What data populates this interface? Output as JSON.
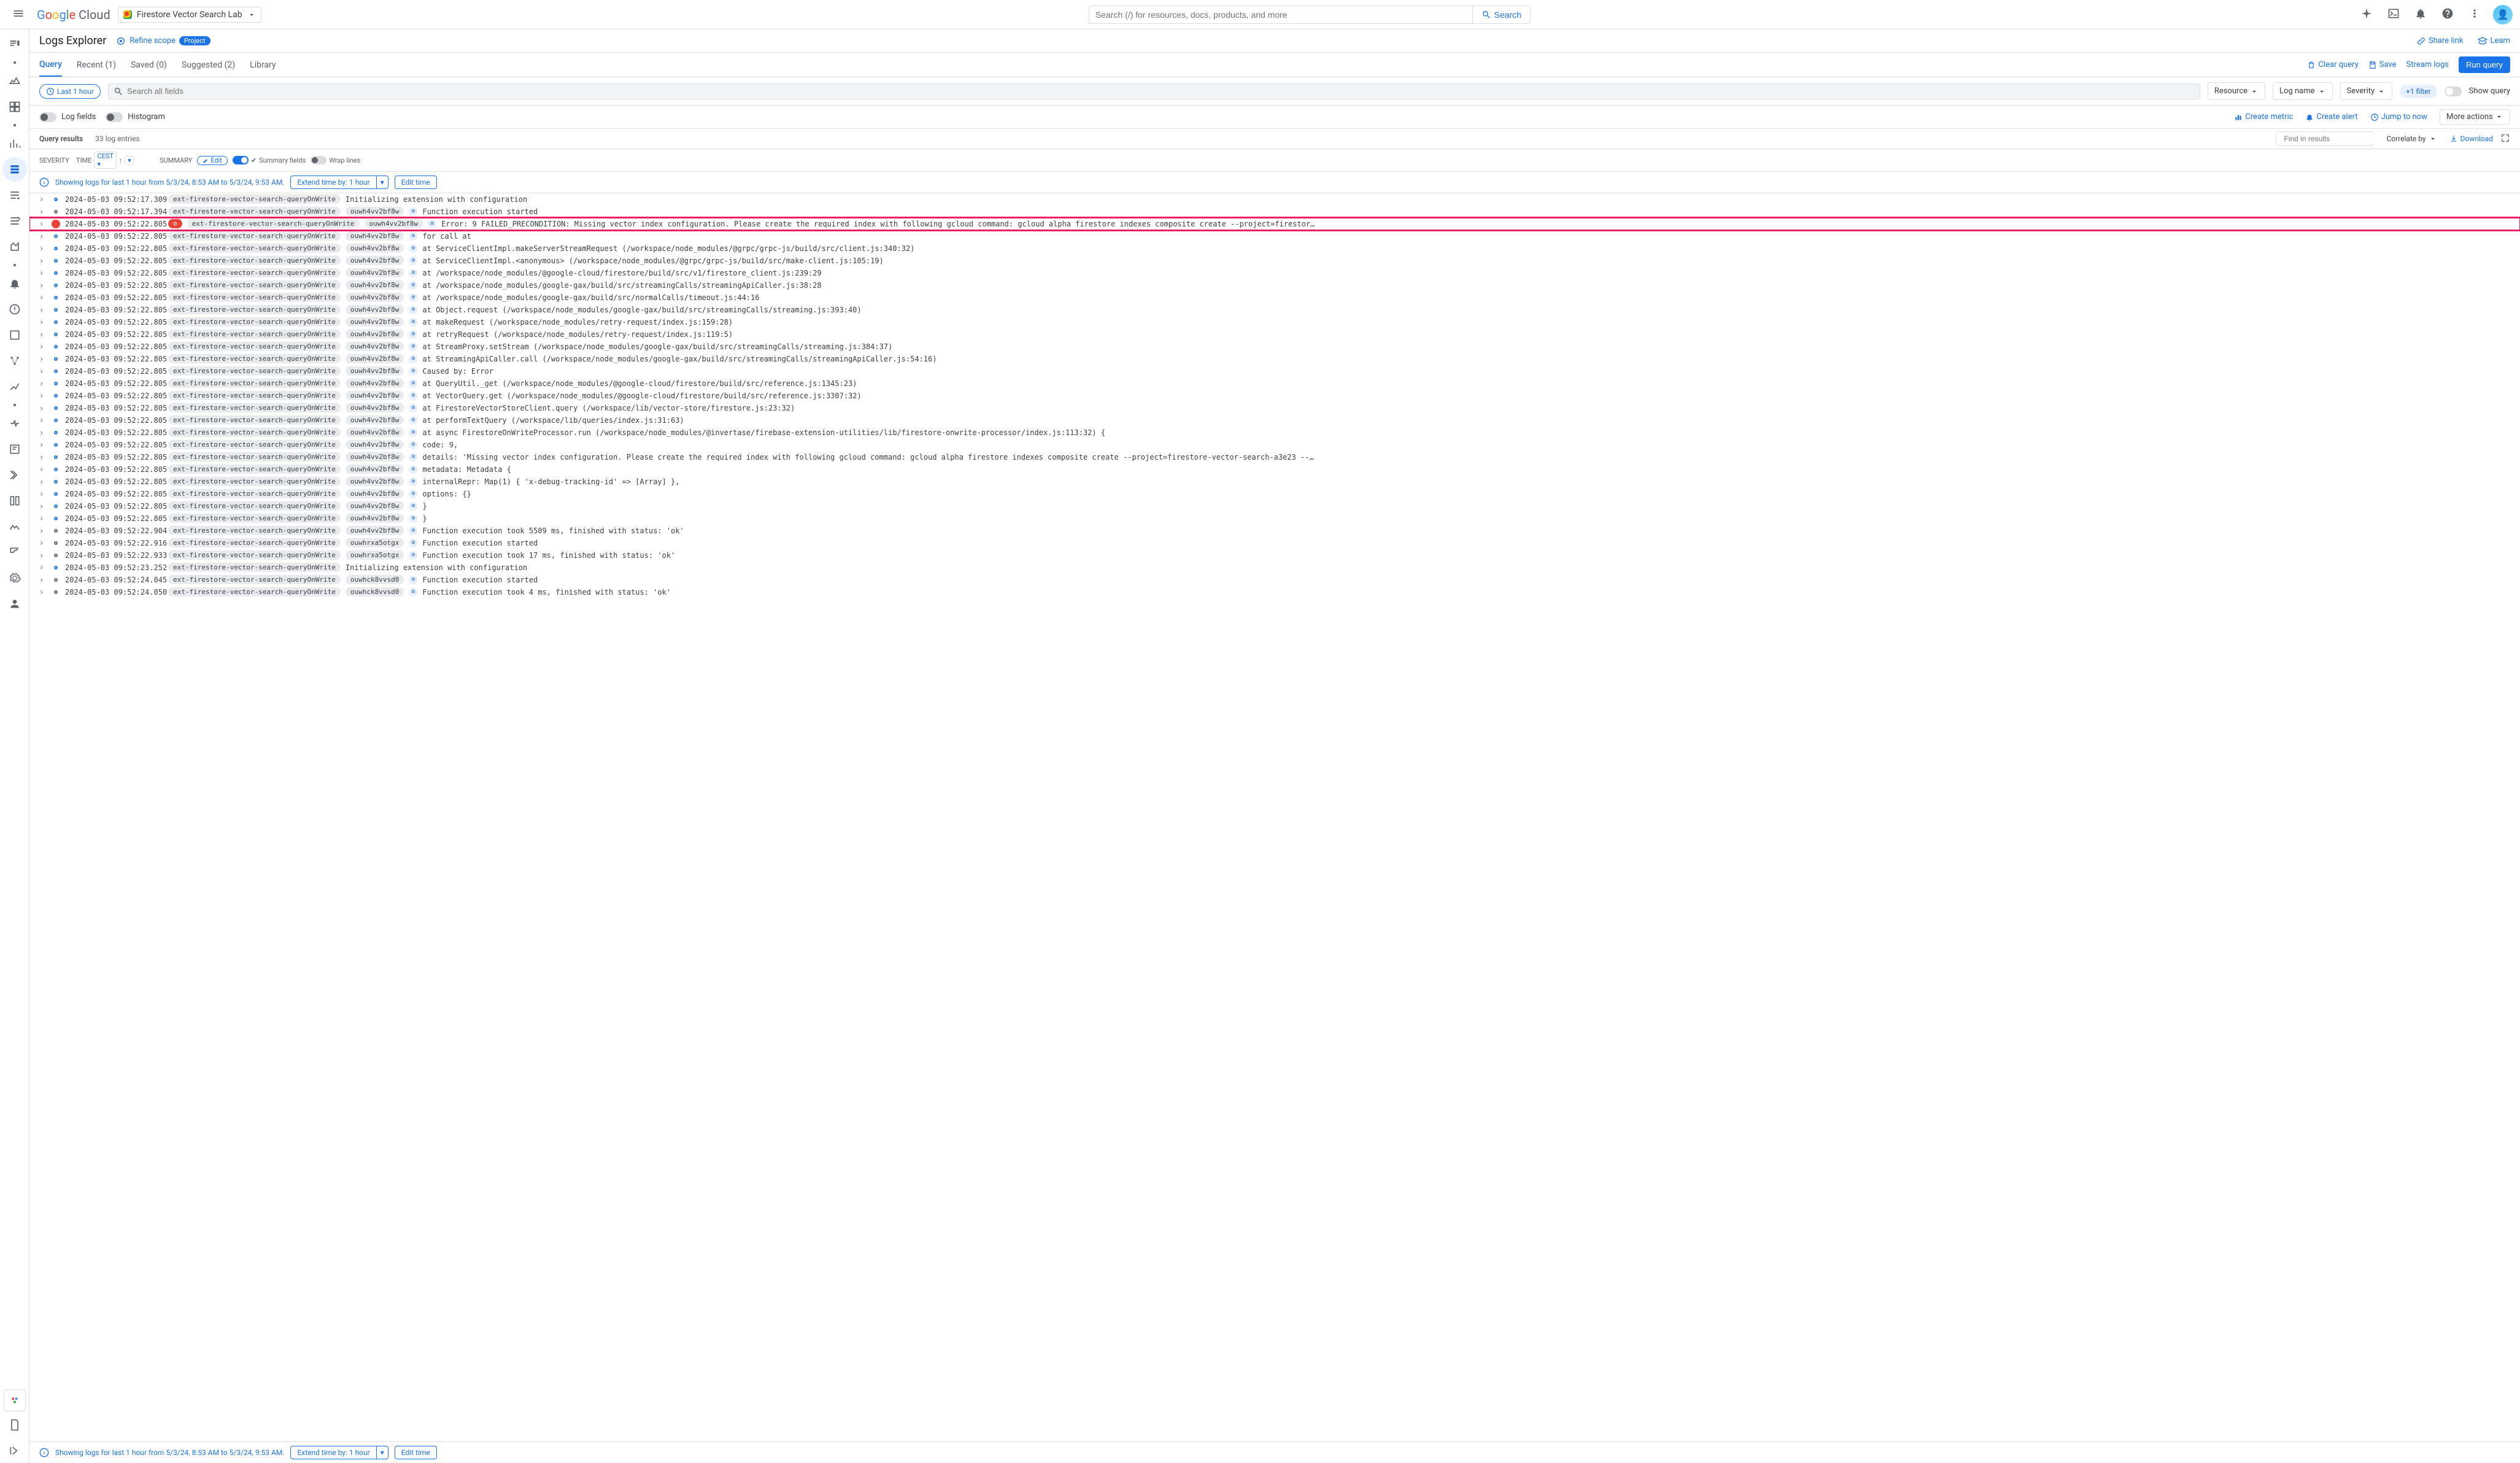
{
  "topbar": {
    "logo_text": "Google Cloud",
    "project_name": "Firestore Vector Search Lab",
    "search_placeholder": "Search (/) for resources, docs, products, and more",
    "search_button": "Search"
  },
  "subheader": {
    "title": "Logs Explorer",
    "refine_label": "Refine scope",
    "scope_chip": "Project",
    "share_link": "Share link",
    "learn": "Learn"
  },
  "tabs": {
    "query": "Query",
    "recent": "Recent (1)",
    "saved": "Saved (0)",
    "suggested": "Suggested (2)",
    "library": "Library",
    "clear_query": "Clear query",
    "save": "Save",
    "stream": "Stream logs",
    "run": "Run query"
  },
  "querybar": {
    "time_chip": "Last 1 hour",
    "search_placeholder": "Search all fields",
    "resource": "Resource",
    "log_name": "Log name",
    "severity": "Severity",
    "filter_chip": "+1 filter",
    "show_query": "Show query"
  },
  "fieldsbar": {
    "log_fields": "Log fields",
    "histogram": "Histogram",
    "create_metric": "Create metric",
    "create_alert": "Create alert",
    "jump": "Jump to now",
    "more": "More actions"
  },
  "results": {
    "label": "Query results",
    "count": "33 log entries",
    "find_placeholder": "Find in results",
    "correlate": "Correlate by",
    "download": "Download"
  },
  "columns": {
    "severity": "SEVERITY",
    "time": "TIME",
    "tz": "CEST",
    "summary": "SUMMARY",
    "edit": "Edit",
    "summary_fields": "Summary fields",
    "wrap": "Wrap lines"
  },
  "info": {
    "text": "Showing logs for last 1 hour from 5/3/24, 8:53 AM to 5/3/24, 9:53 AM.",
    "extend": "Extend time by: 1 hour",
    "edit_time": "Edit time"
  },
  "fn_name": "ext-firestore-vector-search-queryOnWrite",
  "exec_a": "ouwh4vv2bf8w",
  "exec_b": "ouwhrxa5otgx",
  "exec_c": "ouwhck8vvsd0",
  "logs": [
    {
      "sev": "info",
      "ts": "2024-05-03 09:52:17.309",
      "fn": true,
      "exec": "",
      "cf": false,
      "msg": "Initializing extension with configuration",
      "hl": false
    },
    {
      "sev": "debug",
      "ts": "2024-05-03 09:52:17.394",
      "fn": true,
      "exec": "a",
      "cf": true,
      "msg": "Function execution started",
      "hl": false
    },
    {
      "sev": "error",
      "ts": "2024-05-03 09:52:22.805",
      "fn": true,
      "exec": "a",
      "cf": true,
      "errpill": true,
      "msg": "Error: 9 FAILED_PRECONDITION: Missing vector index configuration. Please create the required index with following gcloud command: gcloud alpha firestore indexes composite create --project=firestor…",
      "hl": true
    },
    {
      "sev": "info",
      "ts": "2024-05-03 09:52:22.805",
      "fn": true,
      "exec": "a",
      "cf": true,
      "msg": "for call at",
      "hl": false
    },
    {
      "sev": "info",
      "ts": "2024-05-03 09:52:22.805",
      "fn": true,
      "exec": "a",
      "cf": true,
      "msg": "    at ServiceClientImpl.makeServerStreamRequest (/workspace/node_modules/@grpc/grpc-js/build/src/client.js:340:32)",
      "hl": false
    },
    {
      "sev": "info",
      "ts": "2024-05-03 09:52:22.805",
      "fn": true,
      "exec": "a",
      "cf": true,
      "msg": "    at ServiceClientImpl.<anonymous> (/workspace/node_modules/@grpc/grpc-js/build/src/make-client.js:105:19)",
      "hl": false
    },
    {
      "sev": "info",
      "ts": "2024-05-03 09:52:22.805",
      "fn": true,
      "exec": "a",
      "cf": true,
      "msg": "    at /workspace/node_modules/@google-cloud/firestore/build/src/v1/firestore_client.js:239:29",
      "hl": false
    },
    {
      "sev": "info",
      "ts": "2024-05-03 09:52:22.805",
      "fn": true,
      "exec": "a",
      "cf": true,
      "msg": "    at /workspace/node_modules/google-gax/build/src/streamingCalls/streamingApiCaller.js:38:28",
      "hl": false
    },
    {
      "sev": "info",
      "ts": "2024-05-03 09:52:22.805",
      "fn": true,
      "exec": "a",
      "cf": true,
      "msg": "    at /workspace/node_modules/google-gax/build/src/normalCalls/timeout.js:44:16",
      "hl": false
    },
    {
      "sev": "info",
      "ts": "2024-05-03 09:52:22.805",
      "fn": true,
      "exec": "a",
      "cf": true,
      "msg": "    at Object.request (/workspace/node_modules/google-gax/build/src/streamingCalls/streaming.js:393:40)",
      "hl": false
    },
    {
      "sev": "info",
      "ts": "2024-05-03 09:52:22.805",
      "fn": true,
      "exec": "a",
      "cf": true,
      "msg": "    at makeRequest (/workspace/node_modules/retry-request/index.js:159:28)",
      "hl": false
    },
    {
      "sev": "info",
      "ts": "2024-05-03 09:52:22.805",
      "fn": true,
      "exec": "a",
      "cf": true,
      "msg": "    at retryRequest (/workspace/node_modules/retry-request/index.js:119:5)",
      "hl": false
    },
    {
      "sev": "info",
      "ts": "2024-05-03 09:52:22.805",
      "fn": true,
      "exec": "a",
      "cf": true,
      "msg": "    at StreamProxy.setStream (/workspace/node_modules/google-gax/build/src/streamingCalls/streaming.js:384:37)",
      "hl": false
    },
    {
      "sev": "info",
      "ts": "2024-05-03 09:52:22.805",
      "fn": true,
      "exec": "a",
      "cf": true,
      "msg": "    at StreamingApiCaller.call (/workspace/node_modules/google-gax/build/src/streamingCalls/streamingApiCaller.js:54:16)",
      "hl": false
    },
    {
      "sev": "info",
      "ts": "2024-05-03 09:52:22.805",
      "fn": true,
      "exec": "a",
      "cf": true,
      "msg": "Caused by: Error",
      "hl": false
    },
    {
      "sev": "info",
      "ts": "2024-05-03 09:52:22.805",
      "fn": true,
      "exec": "a",
      "cf": true,
      "msg": "    at QueryUtil._get (/workspace/node_modules/@google-cloud/firestore/build/src/reference.js:1345:23)",
      "hl": false
    },
    {
      "sev": "info",
      "ts": "2024-05-03 09:52:22.805",
      "fn": true,
      "exec": "a",
      "cf": true,
      "msg": "    at VectorQuery.get (/workspace/node_modules/@google-cloud/firestore/build/src/reference.js:3307:32)",
      "hl": false
    },
    {
      "sev": "info",
      "ts": "2024-05-03 09:52:22.805",
      "fn": true,
      "exec": "a",
      "cf": true,
      "msg": "    at FirestoreVectorStoreClient.query (/workspace/lib/vector-store/firestore.js:23:32)",
      "hl": false
    },
    {
      "sev": "info",
      "ts": "2024-05-03 09:52:22.805",
      "fn": true,
      "exec": "a",
      "cf": true,
      "msg": "    at performTextQuery (/workspace/lib/queries/index.js:31:63)",
      "hl": false
    },
    {
      "sev": "info",
      "ts": "2024-05-03 09:52:22.805",
      "fn": true,
      "exec": "a",
      "cf": true,
      "msg": "    at async FirestoreOnWriteProcessor.run (/workspace/node_modules/@invertase/firebase-extension-utilities/lib/firestore-onwrite-processor/index.js:113:32) {",
      "hl": false
    },
    {
      "sev": "info",
      "ts": "2024-05-03 09:52:22.805",
      "fn": true,
      "exec": "a",
      "cf": true,
      "msg": "  code: 9,",
      "hl": false
    },
    {
      "sev": "info",
      "ts": "2024-05-03 09:52:22.805",
      "fn": true,
      "exec": "a",
      "cf": true,
      "msg": "  details: 'Missing vector index configuration. Please create the required index with following gcloud command: gcloud alpha firestore indexes composite create --project=firestore-vector-search-a3e23 --…",
      "hl": false
    },
    {
      "sev": "info",
      "ts": "2024-05-03 09:52:22.805",
      "fn": true,
      "exec": "a",
      "cf": true,
      "msg": "  metadata: Metadata {",
      "hl": false
    },
    {
      "sev": "info",
      "ts": "2024-05-03 09:52:22.805",
      "fn": true,
      "exec": "a",
      "cf": true,
      "msg": "    internalRepr: Map(1) { 'x-debug-tracking-id' => [Array] },",
      "hl": false
    },
    {
      "sev": "info",
      "ts": "2024-05-03 09:52:22.805",
      "fn": true,
      "exec": "a",
      "cf": true,
      "msg": "    options: {}",
      "hl": false
    },
    {
      "sev": "info",
      "ts": "2024-05-03 09:52:22.805",
      "fn": true,
      "exec": "a",
      "cf": true,
      "msg": "  }",
      "hl": false
    },
    {
      "sev": "info",
      "ts": "2024-05-03 09:52:22.805",
      "fn": true,
      "exec": "a",
      "cf": true,
      "msg": "}",
      "hl": false
    },
    {
      "sev": "debug",
      "ts": "2024-05-03 09:52:22.904",
      "fn": true,
      "exec": "a",
      "cf": true,
      "msg": "Function execution took 5509 ms, finished with status: 'ok'",
      "hl": false
    },
    {
      "sev": "debug",
      "ts": "2024-05-03 09:52:22.916",
      "fn": true,
      "exec": "b",
      "cf": true,
      "msg": "Function execution started",
      "hl": false
    },
    {
      "sev": "debug",
      "ts": "2024-05-03 09:52:22.933",
      "fn": true,
      "exec": "b",
      "cf": true,
      "msg": "Function execution took 17 ms, finished with status: 'ok'",
      "hl": false
    },
    {
      "sev": "info",
      "ts": "2024-05-03 09:52:23.252",
      "fn": true,
      "exec": "",
      "cf": false,
      "msg": "Initializing extension with configuration",
      "hl": false
    },
    {
      "sev": "debug",
      "ts": "2024-05-03 09:52:24.045",
      "fn": true,
      "exec": "c",
      "cf": true,
      "msg": "Function execution started",
      "hl": false
    },
    {
      "sev": "debug",
      "ts": "2024-05-03 09:52:24.050",
      "fn": true,
      "exec": "c",
      "cf": true,
      "msg": "Function execution took 4 ms, finished with status: 'ok'",
      "hl": false
    }
  ]
}
